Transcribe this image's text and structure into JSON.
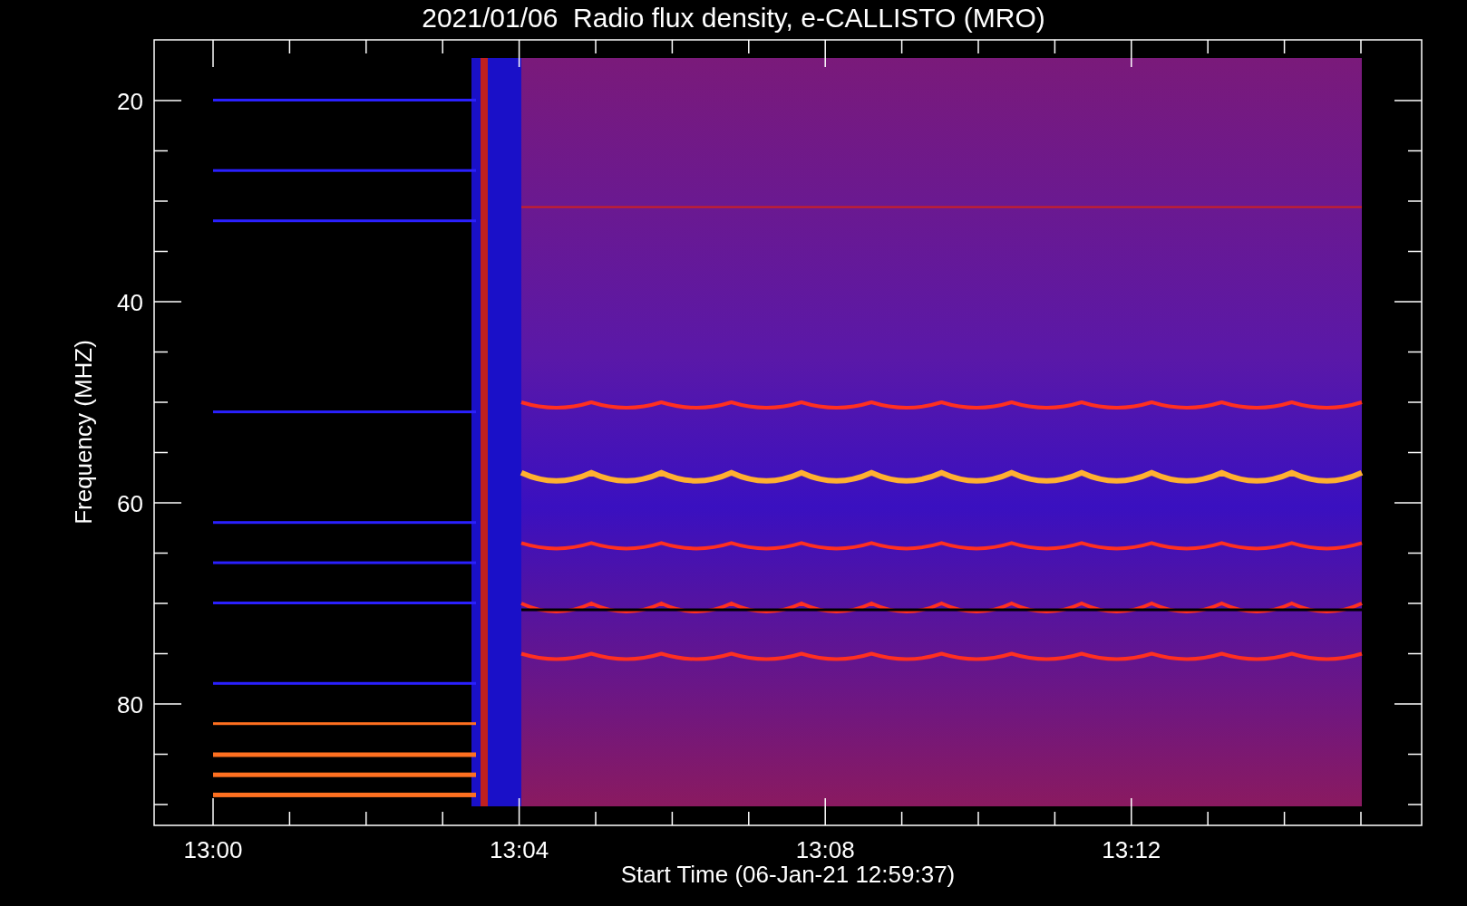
{
  "title": "2021/01/06  Radio flux density, e-CALLISTO (MRO)",
  "plot": {
    "ylabel": "Frequency (MHZ)",
    "xlabel": "Start Time (06-Jan-21 12:59:37)",
    "yticks": [
      "20",
      "40",
      "60",
      "80"
    ],
    "xticks": [
      "13:00",
      "13:04",
      "13:08",
      "13:12"
    ]
  }
}
